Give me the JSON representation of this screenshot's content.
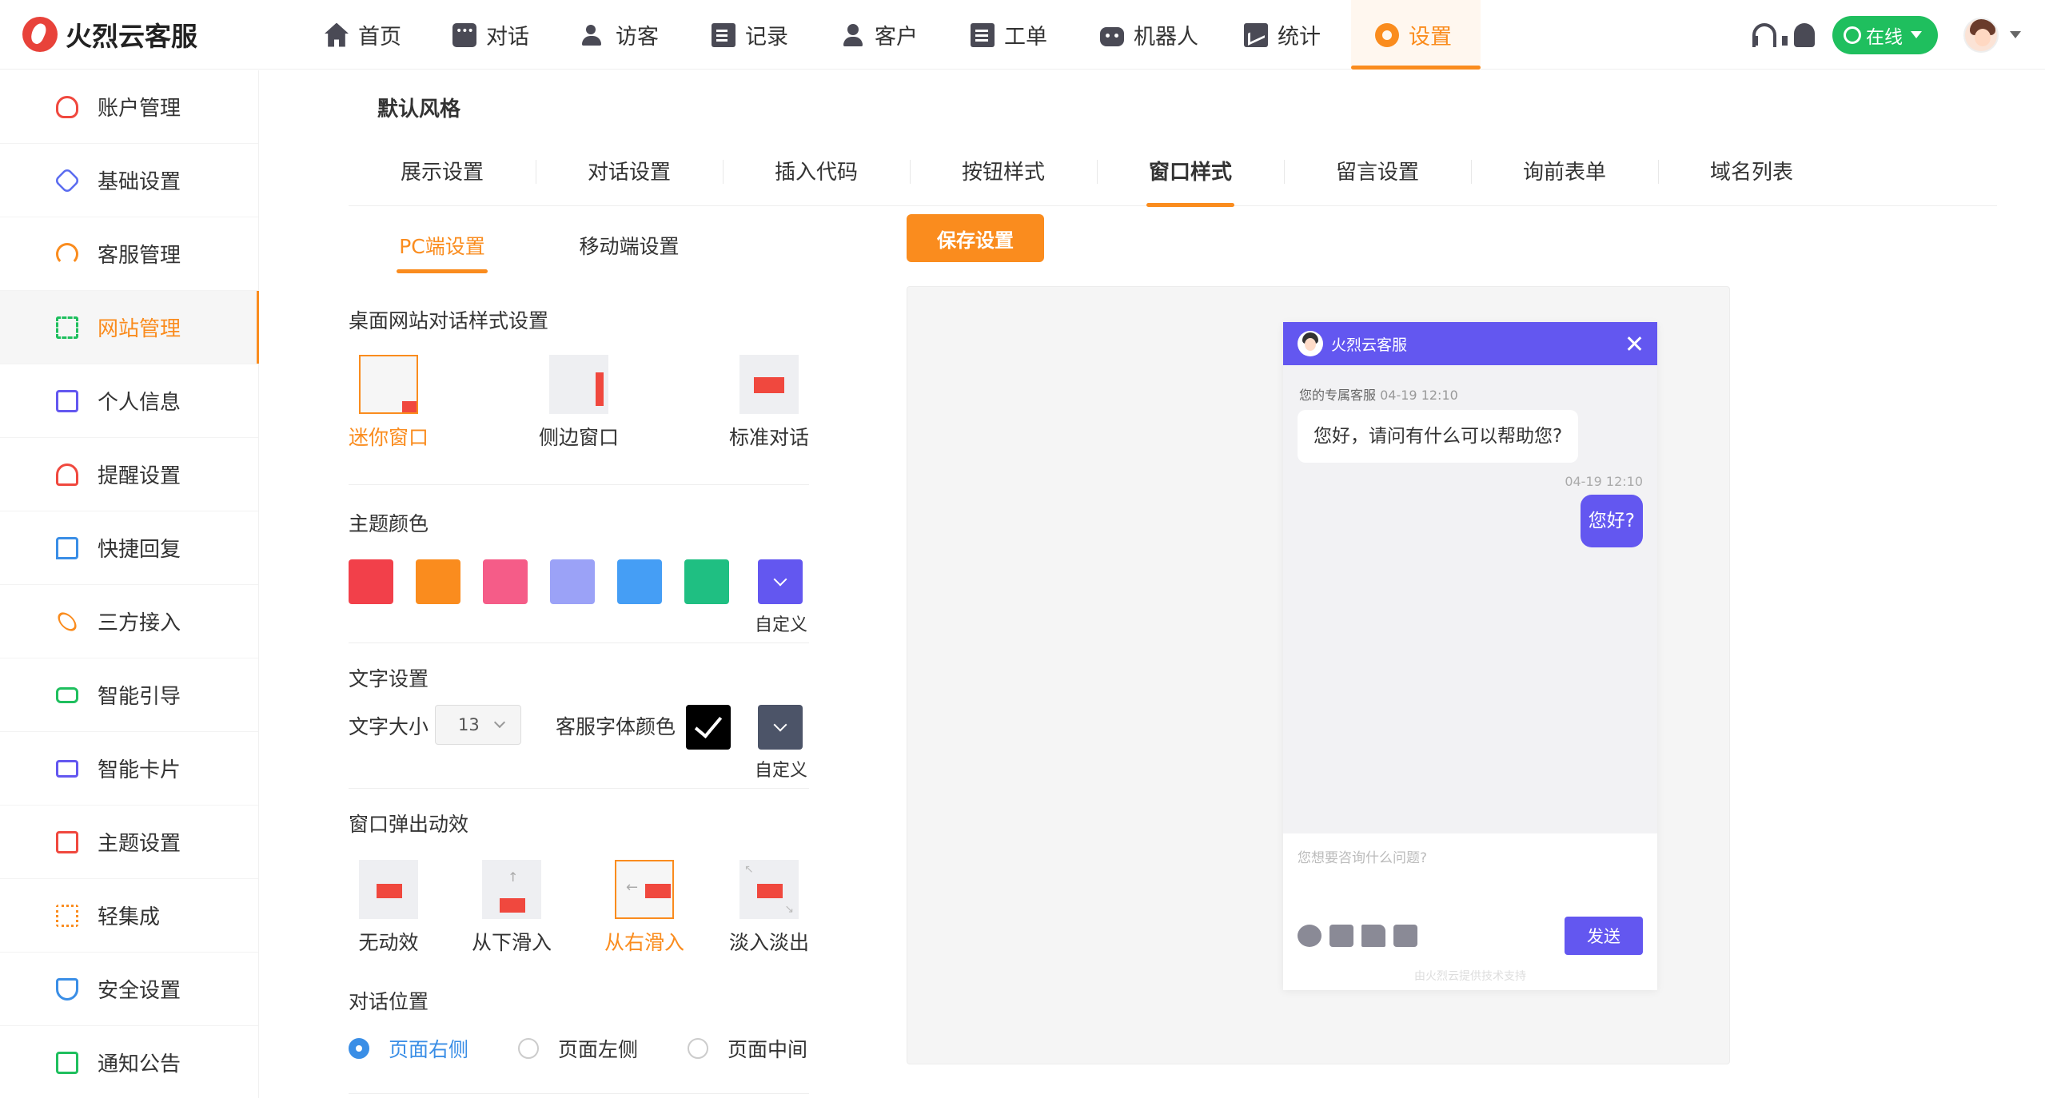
{
  "app": {
    "name": "火烈云客服"
  },
  "nav": [
    {
      "label": "首页",
      "icon": "home-icon"
    },
    {
      "label": "对话",
      "icon": "chat-icon"
    },
    {
      "label": "访客",
      "icon": "visitor-icon"
    },
    {
      "label": "记录",
      "icon": "record-icon"
    },
    {
      "label": "客户",
      "icon": "customer-icon"
    },
    {
      "label": "工单",
      "icon": "ticket-icon"
    },
    {
      "label": "机器人",
      "icon": "robot-icon"
    },
    {
      "label": "统计",
      "icon": "stats-icon"
    },
    {
      "label": "设置",
      "icon": "gear-icon",
      "active": true
    }
  ],
  "header": {
    "status": "在线"
  },
  "sidebar": [
    {
      "label": "账户管理",
      "icon": "user-icon",
      "color": "#f0483e"
    },
    {
      "label": "基础设置",
      "icon": "hexagon-icon",
      "color": "#5b6cf0"
    },
    {
      "label": "客服管理",
      "icon": "headset-icon",
      "color": "#fa8c1e"
    },
    {
      "label": "网站管理",
      "icon": "grid-icon",
      "color": "#1fbf5e",
      "active": true
    },
    {
      "label": "个人信息",
      "icon": "profile-card-icon",
      "color": "#6357f0"
    },
    {
      "label": "提醒设置",
      "icon": "bell-icon",
      "color": "#f0483e"
    },
    {
      "label": "快捷回复",
      "icon": "message-icon",
      "color": "#3a8ee6"
    },
    {
      "label": "三方接入",
      "icon": "link-icon",
      "color": "#fa8c1e"
    },
    {
      "label": "智能引导",
      "icon": "guide-icon",
      "color": "#1fbf5e"
    },
    {
      "label": "智能卡片",
      "icon": "card-icon",
      "color": "#6357f0"
    },
    {
      "label": "主题设置",
      "icon": "theme-icon",
      "color": "#f0483e"
    },
    {
      "label": "轻集成",
      "icon": "integration-icon",
      "color": "#fa8c1e"
    },
    {
      "label": "安全设置",
      "icon": "shield-icon",
      "color": "#3a8ee6"
    },
    {
      "label": "通知公告",
      "icon": "notice-icon",
      "color": "#1fbf5e"
    }
  ],
  "page": {
    "title": "默认风格",
    "tabs": [
      "展示设置",
      "对话设置",
      "插入代码",
      "按钮样式",
      "窗口样式",
      "留言设置",
      "询前表单",
      "域名列表"
    ],
    "active_tab": 4,
    "subtabs": [
      "PC端设置",
      "移动端设置"
    ],
    "save_label": "保存设置"
  },
  "settings": {
    "style_title": "桌面网站对话样式设置",
    "styles": [
      "迷你窗口",
      "侧边窗口",
      "标准对话"
    ],
    "theme_title": "主题颜色",
    "theme_colors": [
      "#f2404a",
      "#fa8c1e",
      "#f55c88",
      "#9ba2f7",
      "#459ef5",
      "#1fbf82",
      "#6357f0"
    ],
    "custom_label": "自定义",
    "text_title": "文字设置",
    "font_size_label": "文字大小",
    "font_size": "13",
    "agent_font_color_label": "客服字体颜色",
    "agent_font_colors": [
      "#000000",
      "#4c5468"
    ],
    "anim_title": "窗口弹出动效",
    "animations": [
      "无动效",
      "从下滑入",
      "从右滑入",
      "淡入淡出"
    ],
    "position_title": "对话位置",
    "positions": [
      "页面右侧",
      "页面左侧",
      "页面中间"
    ]
  },
  "preview": {
    "title": "火烈云客服",
    "agent": "您的专属客服",
    "agent_time": "04-19 12:10",
    "greeting": "您好，请问有什么可以帮助您?",
    "user_time": "04-19 12:10",
    "user_msg": "您好?",
    "placeholder": "您想要咨询什么问题?",
    "send_label": "发送",
    "powered": "由火烈云提供技术支持"
  }
}
